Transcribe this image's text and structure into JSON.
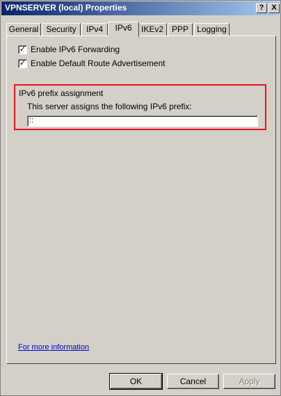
{
  "window": {
    "title": "VPNSERVER (local) Properties"
  },
  "titlebar_buttons": {
    "help": "?",
    "close": "X"
  },
  "tabs": [
    {
      "label": "General"
    },
    {
      "label": "Security"
    },
    {
      "label": "IPv4"
    },
    {
      "label": "IPv6"
    },
    {
      "label": "IKEv2"
    },
    {
      "label": "PPP"
    },
    {
      "label": "Logging"
    }
  ],
  "active_tab": "IPv6",
  "options": {
    "forwarding": {
      "label": "Enable IPv6 Forwarding",
      "checked": true
    },
    "default_route": {
      "label": "Enable Default Route Advertisement",
      "checked": true
    }
  },
  "prefix_group": {
    "title": "IPv6 prefix assignment",
    "description": "This server assigns the following  IPv6 prefix:",
    "value": "::"
  },
  "link": {
    "more_info": "For more information"
  },
  "buttons": {
    "ok": "OK",
    "cancel": "Cancel",
    "apply": "Apply"
  },
  "colors": {
    "highlight": "#e8141c",
    "titlebar": "#0a246a",
    "face": "#d4d0c8"
  }
}
